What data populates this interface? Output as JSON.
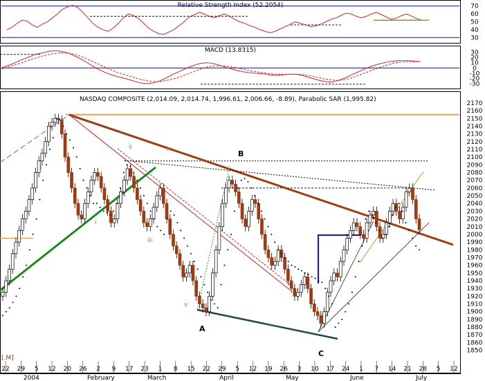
{
  "chart_data": [
    {
      "type": "line",
      "panel": "rsi",
      "title": "Relative Strength Index (52.2054)",
      "y_ticks": [
        30,
        40,
        50,
        60,
        70
      ],
      "ylim": [
        25,
        75
      ],
      "ref_lines": [
        70,
        30
      ],
      "series": [
        {
          "values": [
            40,
            43,
            48,
            52,
            51,
            46,
            43,
            47,
            50,
            55,
            60,
            66,
            69,
            71,
            68,
            62,
            55,
            48,
            43,
            40,
            38,
            42,
            48,
            55,
            60,
            58,
            54,
            48,
            42,
            38,
            35,
            34,
            37,
            40,
            45,
            50,
            56,
            59,
            62,
            60,
            57,
            55,
            58,
            60,
            57,
            53,
            50,
            48,
            45,
            43,
            40,
            38,
            36,
            38,
            41,
            44,
            47,
            50,
            48,
            46,
            44,
            45,
            47,
            50,
            53,
            55,
            58,
            61,
            60,
            57,
            55,
            57,
            60,
            62,
            59,
            56,
            53,
            55,
            58,
            60,
            57,
            54,
            52
          ]
        }
      ]
    },
    {
      "type": "line",
      "panel": "macd",
      "title": "MACD (13.8315)",
      "y_ticks": [
        -30,
        -20,
        -10,
        0,
        10,
        20,
        30
      ],
      "ylim": [
        -38,
        40
      ],
      "series": [
        {
          "values": [
            0,
            5,
            10,
            16,
            21,
            26,
            29,
            32,
            33,
            31,
            27,
            21,
            14,
            6,
            -2,
            -8,
            -13,
            -17,
            -20,
            -24,
            -28,
            -30,
            -29,
            -25,
            -19,
            -12,
            -6,
            0,
            5,
            9,
            10,
            8,
            4,
            0,
            -4,
            -7,
            -9,
            -10,
            -11,
            -13,
            -14,
            -13,
            -12,
            -12,
            -15,
            -19,
            -23,
            -26,
            -27,
            -24,
            -19,
            -13,
            -7,
            -1,
            4,
            8,
            11,
            13,
            14,
            14,
            13,
            12
          ]
        },
        {
          "values": [
            -2,
            2,
            6,
            10,
            15,
            19,
            23,
            26,
            28,
            29,
            28,
            25,
            20,
            14,
            8,
            2,
            -4,
            -9,
            -13,
            -17,
            -21,
            -24,
            -26,
            -26,
            -24,
            -21,
            -17,
            -12,
            -7,
            -2,
            2,
            4,
            4,
            3,
            1,
            -2,
            -5,
            -7,
            -9,
            -11,
            -12,
            -12,
            -12,
            -12,
            -13,
            -15,
            -18,
            -21,
            -23,
            -24,
            -22,
            -19,
            -14,
            -9,
            -4,
            1,
            5,
            9,
            11,
            12,
            12,
            12
          ]
        }
      ]
    },
    {
      "type": "candlestick",
      "panel": "price",
      "title": "NASDAQ COMPOSITE (2,014.09, 2,014.74, 1,996.61, 2,006.66, -8.89), Parabolic SAR (1,995.82)",
      "ylim": [
        1838,
        2178
      ],
      "y_ticks": [
        1850,
        1860,
        1870,
        1880,
        1890,
        1900,
        1910,
        1920,
        1930,
        1940,
        1950,
        1960,
        1970,
        1980,
        1990,
        2000,
        2010,
        2020,
        2030,
        2040,
        2050,
        2060,
        2070,
        2080,
        2090,
        2100,
        2110,
        2120,
        2130,
        2140,
        2150,
        2160,
        2170
      ],
      "x_day_labels": [
        "22",
        "29",
        "5",
        "12",
        "20",
        "26",
        "2",
        "9",
        "17",
        "23",
        "1",
        "8",
        "15",
        "22",
        "29",
        "5",
        "12",
        "19",
        "26",
        "3",
        "10",
        "17",
        "24",
        "1",
        "7",
        "14",
        "21",
        "28",
        "5",
        "12"
      ],
      "x_month_labels": [
        "2004",
        "February",
        "March",
        "April",
        "May",
        "June",
        "July"
      ],
      "close": [
        1925,
        1940,
        1955,
        1975,
        1990,
        2005,
        2020,
        2030,
        2045,
        2060,
        2080,
        2095,
        2105,
        2120,
        2140,
        2145,
        2150,
        2148,
        2130,
        2100,
        2080,
        2060,
        2040,
        2025,
        2020,
        2040,
        2055,
        2070,
        2080,
        2075,
        2060,
        2045,
        2030,
        2015,
        2020,
        2040,
        2055,
        2070,
        2085,
        2075,
        2060,
        2045,
        2030,
        2015,
        2010,
        2020,
        2035,
        2050,
        2060,
        2040,
        2020,
        2000,
        1985,
        1975,
        1960,
        1945,
        1950,
        1960,
        1940,
        1920,
        1910,
        1905,
        1900,
        1920,
        1950,
        1980,
        2010,
        2040,
        2060,
        2070,
        2065,
        2055,
        2040,
        2020,
        2010,
        2030,
        2045,
        2040,
        2020,
        2000,
        1980,
        1970,
        1960,
        1965,
        1980,
        1970,
        1955,
        1940,
        1930,
        1920,
        1925,
        1935,
        1945,
        1930,
        1910,
        1900,
        1895,
        1885,
        1900,
        1925,
        1940,
        1950,
        1945,
        1965,
        1980,
        1995,
        2005,
        2015,
        2010,
        2000,
        1995,
        2015,
        2025,
        2030,
        2010,
        1995,
        2000,
        2015,
        2030,
        2040,
        2030,
        2020,
        2035,
        2055,
        2060,
        2045,
        2020,
        2006
      ],
      "sar": [
        1895,
        1900,
        1905,
        1912,
        1920,
        1930,
        1945,
        1960,
        1980,
        2000,
        2020,
        2045,
        2070,
        2090,
        2110,
        2125,
        2150,
        2148,
        2140,
        2130,
        2122,
        2112,
        2100,
        2085,
        2070,
        2060,
        2050,
        2040,
        2040,
        2035,
        2030,
        2028,
        2025,
        2030,
        2040,
        2060,
        2080,
        2090,
        2088,
        2080,
        2070,
        2060,
        2050,
        2040,
        2030,
        2020,
        2010,
        2005,
        2000,
        2020,
        2030,
        2025,
        2015,
        2005,
        1995,
        1985,
        1975,
        1965,
        1955,
        1945,
        1935,
        1925,
        1915,
        1910,
        1905,
        1935,
        1960,
        1980,
        2000,
        2030,
        2060,
        2070,
        2072,
        2068,
        2060,
        2050,
        2040,
        2030,
        2020,
        2010,
        2000,
        1990,
        1980,
        1975,
        1970,
        1965,
        1960,
        1958,
        1955,
        1953,
        1950,
        1948,
        1945,
        1943,
        1940,
        1938,
        1930,
        1920,
        1910,
        1880,
        1885,
        1890,
        1900,
        1910,
        1925,
        1945,
        1965,
        1985,
        2020,
        2030,
        2025,
        2015,
        2005,
        1995,
        2000,
        2010,
        2025,
        2035,
        2040,
        2030,
        2015,
        2005,
        1995,
        1985,
        1980
      ]
    }
  ],
  "annotations": {
    "A": "A",
    "B": "B",
    "C": "C",
    "i": "i",
    "ii": "ii",
    "iii": "iii",
    "iv": "iv",
    "v": "v",
    "corner": "[.M]"
  },
  "colors": {
    "rsi_line": "#e02020",
    "ref_line": "#1010a0",
    "trend_main": "#a03a10",
    "top_line": "#f0a050",
    "green_trend": "#1a8a1a",
    "base_line": "#1a4a4a",
    "box": "#1010e0",
    "candle_up": "#ffffff",
    "candle_down": "#a03a10"
  }
}
